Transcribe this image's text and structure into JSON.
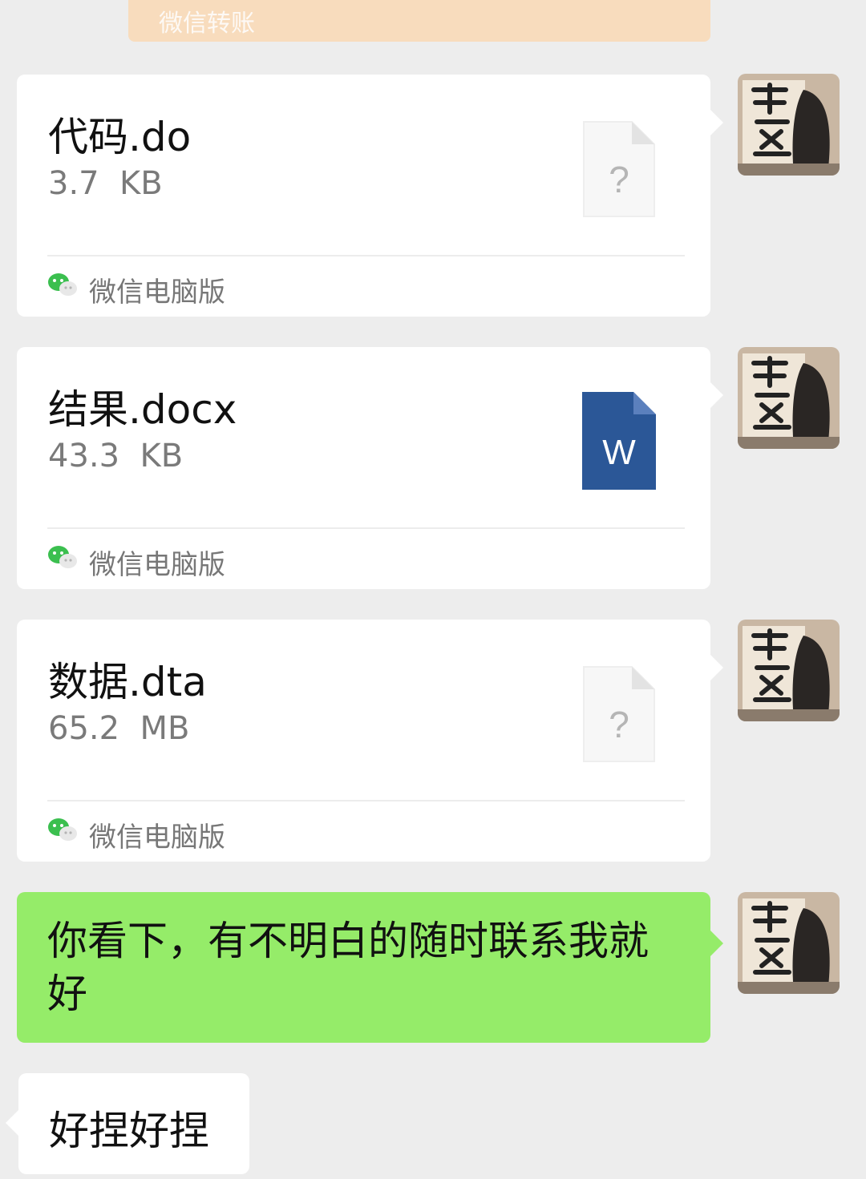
{
  "transfer": {
    "label": "微信转账"
  },
  "messages": [
    {
      "file_name": "代码.do",
      "file_size": "3.7  KB",
      "source": "微信电脑版",
      "file_icon": "unknown-file-icon"
    },
    {
      "file_name": "结果.docx",
      "file_size": "43.3  KB",
      "source": "微信电脑版",
      "file_icon": "word-file-icon",
      "icon_letter": "W"
    },
    {
      "file_name": "数据.dta",
      "file_size": "65.2  MB",
      "source": "微信电脑版",
      "file_icon": "unknown-file-icon"
    }
  ],
  "outgoing_text": {
    "text": "你看下，有不明白的随时联系我就好"
  },
  "incoming_text": {
    "text": "好捏好捏"
  },
  "colors": {
    "chat_background": "#ededed",
    "outgoing_bubble": "#95ec69",
    "incoming_bubble": "#ffffff",
    "word_blue": "#2b5797",
    "transfer_orange": "#f8dcbd",
    "wechat_green": "#07c160"
  }
}
